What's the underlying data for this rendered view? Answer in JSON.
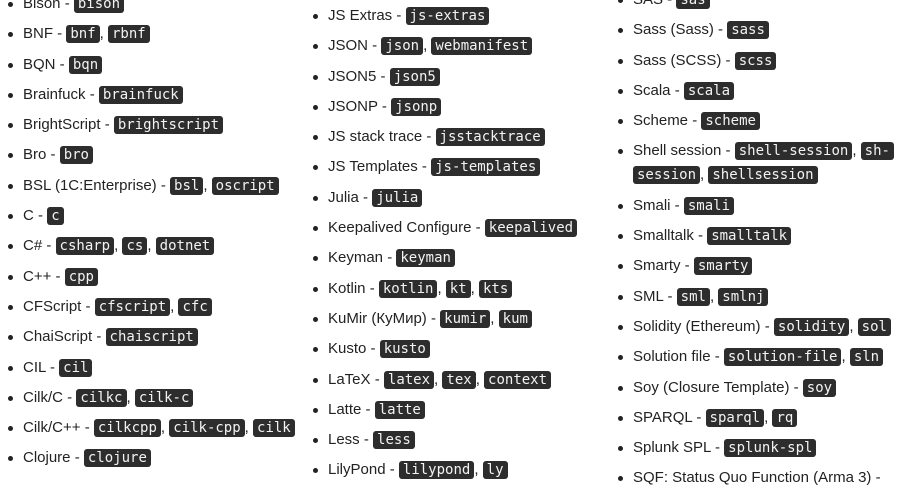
{
  "columns": [
    [
      {
        "name": "Bison",
        "aliases": [
          "bison"
        ]
      },
      {
        "name": "BNF",
        "aliases": [
          "bnf",
          "rbnf"
        ]
      },
      {
        "name": "BQN",
        "aliases": [
          "bqn"
        ]
      },
      {
        "name": "Brainfuck",
        "aliases": [
          "brainfuck"
        ]
      },
      {
        "name": "BrightScript",
        "aliases": [
          "brightscript"
        ]
      },
      {
        "name": "Bro",
        "aliases": [
          "bro"
        ]
      },
      {
        "name": "BSL (1C:Enterprise)",
        "aliases": [
          "bsl",
          "oscript"
        ]
      },
      {
        "name": "C",
        "aliases": [
          "c"
        ]
      },
      {
        "name": "C#",
        "aliases": [
          "csharp",
          "cs",
          "dotnet"
        ]
      },
      {
        "name": "C++",
        "aliases": [
          "cpp"
        ]
      },
      {
        "name": "CFScript",
        "aliases": [
          "cfscript",
          "cfc"
        ]
      },
      {
        "name": "ChaiScript",
        "aliases": [
          "chaiscript"
        ]
      },
      {
        "name": "CIL",
        "aliases": [
          "cil"
        ]
      },
      {
        "name": "Cilk/C",
        "aliases": [
          "cilkc",
          "cilk-c"
        ]
      },
      {
        "name": "Cilk/C++",
        "aliases": [
          "cilkcpp",
          "cilk-cpp",
          "cilk"
        ]
      },
      {
        "name": "Clojure",
        "aliases": [
          "clojure"
        ]
      }
    ],
    [
      {
        "name": "JS Extras",
        "aliases": [
          "js-extras"
        ]
      },
      {
        "name": "JSON",
        "aliases": [
          "json",
          "webmanifest"
        ]
      },
      {
        "name": "JSON5",
        "aliases": [
          "json5"
        ]
      },
      {
        "name": "JSONP",
        "aliases": [
          "jsonp"
        ]
      },
      {
        "name": "JS stack trace",
        "aliases": [
          "jsstacktrace"
        ]
      },
      {
        "name": "JS Templates",
        "aliases": [
          "js-templates"
        ]
      },
      {
        "name": "Julia",
        "aliases": [
          "julia"
        ]
      },
      {
        "name": "Keepalived Configure",
        "aliases": [
          "keepalived"
        ]
      },
      {
        "name": "Keyman",
        "aliases": [
          "keyman"
        ]
      },
      {
        "name": "Kotlin",
        "aliases": [
          "kotlin",
          "kt",
          "kts"
        ]
      },
      {
        "name": "KuMir (КуМир)",
        "aliases": [
          "kumir",
          "kum"
        ]
      },
      {
        "name": "Kusto",
        "aliases": [
          "kusto"
        ]
      },
      {
        "name": "LaTeX",
        "aliases": [
          "latex",
          "tex",
          "context"
        ]
      },
      {
        "name": "Latte",
        "aliases": [
          "latte"
        ]
      },
      {
        "name": "Less",
        "aliases": [
          "less"
        ]
      },
      {
        "name": "LilyPond",
        "aliases": [
          "lilypond",
          "ly"
        ]
      }
    ],
    [
      {
        "name": "SAS",
        "aliases": [
          "sas"
        ]
      },
      {
        "name": "Sass (Sass)",
        "aliases": [
          "sass"
        ]
      },
      {
        "name": "Sass (SCSS)",
        "aliases": [
          "scss"
        ]
      },
      {
        "name": "Scala",
        "aliases": [
          "scala"
        ]
      },
      {
        "name": "Scheme",
        "aliases": [
          "scheme"
        ]
      },
      {
        "name": "Shell session",
        "aliases": [
          "shell-session",
          "sh-session",
          "shellsession"
        ]
      },
      {
        "name": "Smali",
        "aliases": [
          "smali"
        ]
      },
      {
        "name": "Smalltalk",
        "aliases": [
          "smalltalk"
        ]
      },
      {
        "name": "Smarty",
        "aliases": [
          "smarty"
        ]
      },
      {
        "name": "SML",
        "aliases": [
          "sml",
          "smlnj"
        ]
      },
      {
        "name": "Solidity (Ethereum)",
        "aliases": [
          "solidity",
          "sol"
        ]
      },
      {
        "name": "Solution file",
        "aliases": [
          "solution-file",
          "sln"
        ]
      },
      {
        "name": "Soy (Closure Template)",
        "aliases": [
          "soy"
        ]
      },
      {
        "name": "SPARQL",
        "aliases": [
          "sparql",
          "rq"
        ]
      },
      {
        "name": "Splunk SPL",
        "aliases": [
          "splunk-spl"
        ]
      },
      {
        "name": "SQF: Status Quo Function (Arma 3)",
        "aliases": []
      }
    ]
  ],
  "separators": {
    "name_alias": " - ",
    "alias_alias": ", "
  }
}
